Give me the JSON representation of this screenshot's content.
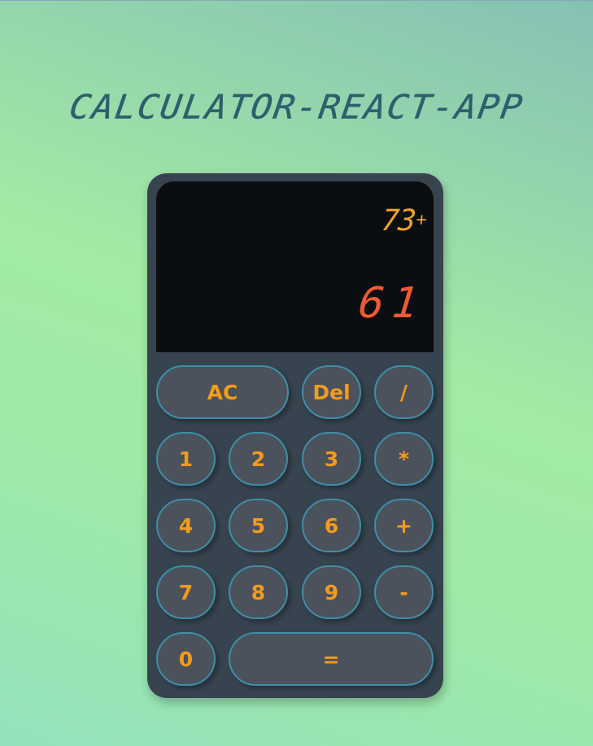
{
  "app": {
    "title": "CALCULATOR-REACT-APP"
  },
  "display": {
    "previous_operand": "73",
    "operation": "+",
    "current_operand": "61"
  },
  "colors": {
    "calculator_body": "#37444f",
    "display_background": "#0b0e11",
    "key_background": "#4b525c",
    "key_border": "#3f8ea7",
    "key_text": "#f59b1c",
    "previous_text": "#f0a32a",
    "current_text": "#ef5a33",
    "title_text": "#2f5f6d"
  },
  "keys": {
    "ac": "AC",
    "del": "Del",
    "divide": "/",
    "one": "1",
    "two": "2",
    "three": "3",
    "multiply": "*",
    "four": "4",
    "five": "5",
    "six": "6",
    "plus": "+",
    "seven": "7",
    "eight": "8",
    "nine": "9",
    "minus": "-",
    "zero": "0",
    "equals": "="
  }
}
